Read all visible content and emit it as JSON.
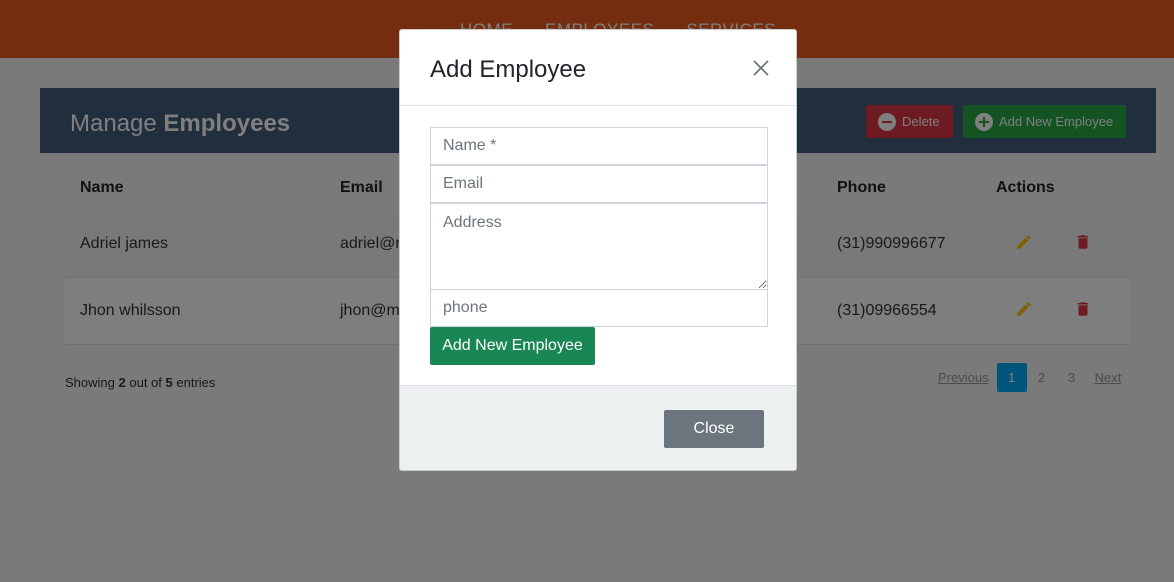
{
  "nav": {
    "items": [
      "HOME",
      "EMPLOYEES",
      "SERVICES"
    ]
  },
  "header": {
    "title_prefix": "Manage",
    "title_strong": "Employees",
    "delete_label": "Delete",
    "add_label": "Add New Employee"
  },
  "table": {
    "columns": [
      "Name",
      "Email",
      "Phone",
      "Actions"
    ],
    "rows": [
      {
        "name": "Adriel james",
        "email": "adriel@r",
        "phone": "(31)990996677"
      },
      {
        "name": "Jhon whilsson",
        "email": "jhon@m",
        "phone": "(31)09966554"
      }
    ]
  },
  "footer": {
    "showing_prefix": "Showing",
    "shown_count": "2",
    "out_of": "out of",
    "total_count": "5",
    "entries": "entries"
  },
  "pagination": {
    "previous": "Previous",
    "pages": [
      "1",
      "2",
      "3"
    ],
    "active_page": "1",
    "next": "Next"
  },
  "modal": {
    "title": "Add Employee",
    "name_placeholder": "Name *",
    "email_placeholder": "Email",
    "address_placeholder": "Address",
    "phone_placeholder": "phone",
    "submit_label": "Add New Employee",
    "close_label": "Close"
  },
  "colors": {
    "navbar": "#e85d1e",
    "header_bar": "#435d7d",
    "delete": "#dc3545",
    "add": "#28a745",
    "submit": "#198754",
    "edit_icon": "#ffc107",
    "trash_icon": "#dc3545",
    "active_page": "#03a9f4"
  },
  "icons": {
    "close": "close-icon",
    "edit": "pencil-icon",
    "delete": "trash-icon"
  }
}
